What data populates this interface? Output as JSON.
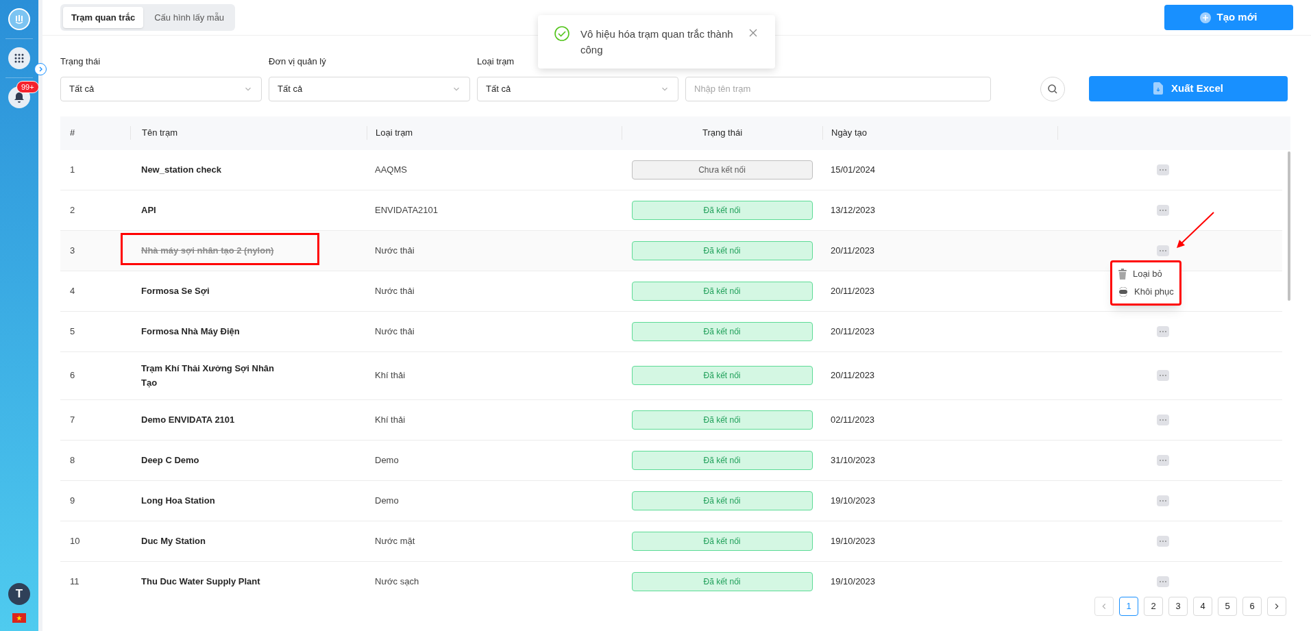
{
  "sidebar": {
    "badge": "99+",
    "avatar": "T"
  },
  "tabs": [
    {
      "label": "Trạm quan trắc",
      "selected": true
    },
    {
      "label": "Cấu hình lấy mẫu",
      "selected": false
    }
  ],
  "create_button": "Tạo mới",
  "toast": {
    "message": "Vô hiệu hóa trạm quan trắc thành công"
  },
  "filters": [
    {
      "label": "Trạng thái",
      "value": "Tất cả"
    },
    {
      "label": "Đơn vị quản lý",
      "value": "Tất cả"
    },
    {
      "label": "Loại trạm",
      "value": "Tất cả"
    }
  ],
  "search": {
    "placeholder": "Nhập tên trạm"
  },
  "export_button": "Xuất Excel",
  "table": {
    "columns": [
      "#",
      "Tên trạm",
      "Loại trạm",
      "Trạng thái",
      "Ngày tạo"
    ],
    "rows": [
      {
        "index": "1",
        "name": "New_station check",
        "type": "AAQMS",
        "status": "Chưa kết nối",
        "connected": false,
        "disabled": false,
        "date": "15/01/2024"
      },
      {
        "index": "2",
        "name": "API",
        "type": "ENVIDATA2101",
        "status": "Đã kết nối",
        "connected": true,
        "disabled": false,
        "date": "13/12/2023"
      },
      {
        "index": "3",
        "name": "Nhà máy sợi nhân tạo 2 (nylon)",
        "type": "Nước thải",
        "status": "Đã kết nối",
        "connected": true,
        "disabled": true,
        "date": "20/11/2023"
      },
      {
        "index": "4",
        "name": "Formosa Se Sợi",
        "type": "Nước thải",
        "status": "Đã kết nối",
        "connected": true,
        "disabled": false,
        "date": "20/11/2023"
      },
      {
        "index": "5",
        "name": "Formosa Nhà Máy Điện",
        "type": "Nước thải",
        "status": "Đã kết nối",
        "connected": true,
        "disabled": false,
        "date": "20/11/2023"
      },
      {
        "index": "6",
        "name": "Trạm Khí Thải Xưởng Sợi Nhân Tạo",
        "type": "Khí thải",
        "status": "Đã kết nối",
        "connected": true,
        "disabled": false,
        "date": "20/11/2023"
      },
      {
        "index": "7",
        "name": "Demo ENVIDATA 2101",
        "type": "Khí thải",
        "status": "Đã kết nối",
        "connected": true,
        "disabled": false,
        "date": "02/11/2023"
      },
      {
        "index": "8",
        "name": "Deep C Demo",
        "type": "Demo",
        "status": "Đã kết nối",
        "connected": true,
        "disabled": false,
        "date": "31/10/2023"
      },
      {
        "index": "9",
        "name": "Long Hoa Station",
        "type": "Demo",
        "status": "Đã kết nối",
        "connected": true,
        "disabled": false,
        "date": "19/10/2023"
      },
      {
        "index": "10",
        "name": "Duc My Station",
        "type": "Nước mặt",
        "status": "Đã kết nối",
        "connected": true,
        "disabled": false,
        "date": "19/10/2023"
      },
      {
        "index": "11",
        "name": "Thu Duc Water Supply Plant",
        "type": "Nước sạch",
        "status": "Đã kết nối",
        "connected": true,
        "disabled": false,
        "date": "19/10/2023"
      }
    ]
  },
  "row_menu": {
    "items": [
      {
        "label": "Loại bỏ",
        "kind": "remove"
      },
      {
        "label": "Khôi phục",
        "kind": "restore"
      }
    ]
  },
  "pagination": [
    {
      "label": "1",
      "selected": true
    },
    {
      "label": "2",
      "selected": false
    },
    {
      "label": "3",
      "selected": false
    },
    {
      "label": "4",
      "selected": false
    },
    {
      "label": "5",
      "selected": false
    },
    {
      "label": "6",
      "selected": false
    }
  ]
}
